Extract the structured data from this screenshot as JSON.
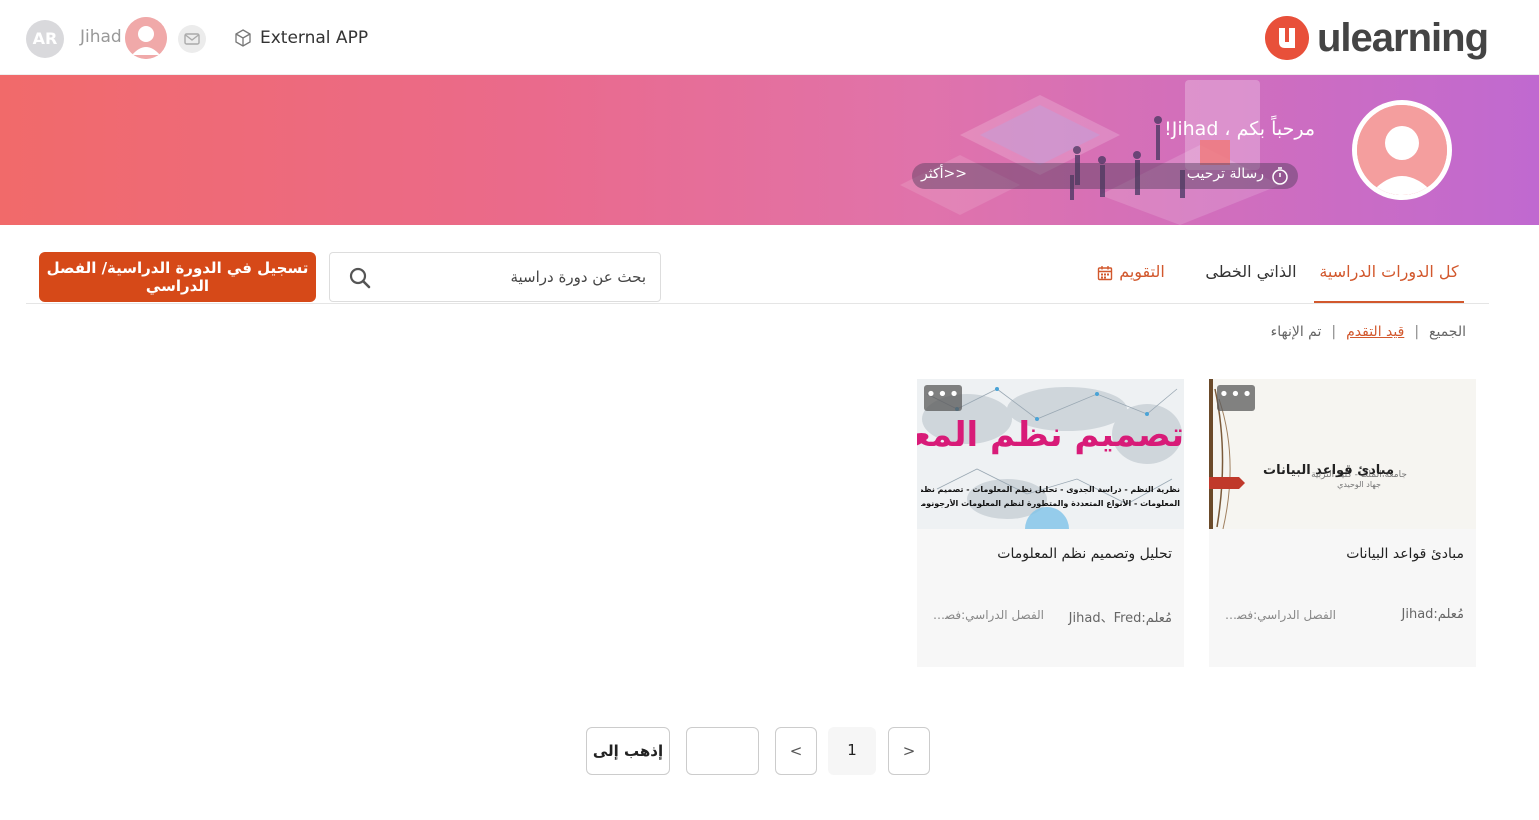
{
  "topbar": {
    "lang_badge": "AR",
    "user_name": "Jihad",
    "external_app_label": "External APP",
    "logo_text": "ulearning",
    "brand_color": "#e8503a"
  },
  "banner": {
    "welcome": "مرحباً بكم ، Jihad!",
    "message_label": "رسالة ترحيب",
    "more_label": "أكثر>>"
  },
  "tabs": [
    {
      "label": "كل الدورات الدراسية",
      "active": true
    },
    {
      "label": "الذاتي الخطى",
      "active": false
    },
    {
      "label": "التقويم",
      "active": false,
      "icon": "calendar-icon"
    }
  ],
  "search": {
    "placeholder": "بحث عن دورة دراسية"
  },
  "enroll_button": "تسجيل في الدورة الدراسية/ الفصل الدراسي",
  "filters": [
    {
      "label": "الجميع",
      "active": false
    },
    {
      "label": "قيد التقدم",
      "active": true
    },
    {
      "label": "تم الإنهاء",
      "active": false
    }
  ],
  "courses": [
    {
      "cover_title": "مبادئ قواعد البيانات",
      "title": "مبادئ قواعد البيانات",
      "teacher": "مُعلم:Jihad",
      "term": "الفصل الدراسي:فصل ...",
      "menu": "•••"
    },
    {
      "cover_title": "تصميم نظم المعلومات",
      "cover_subtitle_1": "نظرية النظم - دراسة الجدوى - تحليل نظم المعلومات - تصميم نظم",
      "cover_subtitle_2": "المعلومات - الأنواع المتعددة والمتطورة لنظم المعلومات الأرجونوميكس",
      "title": "تحليل وتصميم نظم المعلومات",
      "teacher": "مُعلم:Jihad、Fred",
      "term": "الفصل الدراسي:فصل ...",
      "menu": "•••"
    }
  ],
  "pagination": {
    "next": ">",
    "current": "1",
    "prev": "<",
    "goto_label": "إذهب إلى"
  }
}
